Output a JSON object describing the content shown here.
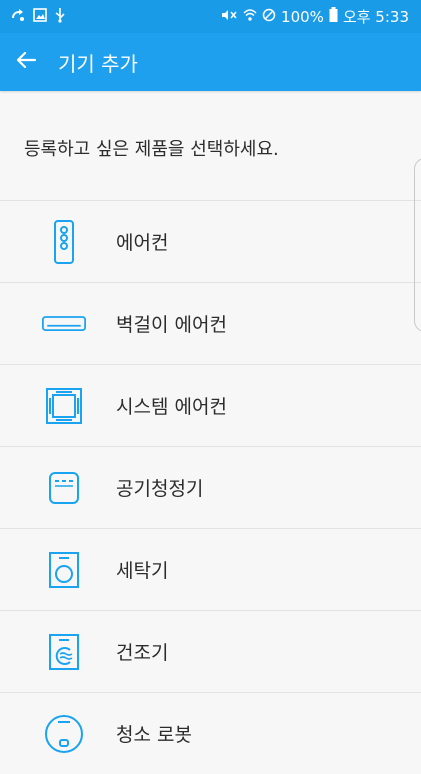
{
  "status_bar": {
    "battery_text": "100%",
    "time_text": "오후 5:33",
    "left_icons": [
      "sync-icon",
      "gallery-icon",
      "usb-icon"
    ],
    "right_icons": [
      "mute-icon",
      "wifi-icon",
      "no-disturb-icon",
      "battery-icon"
    ]
  },
  "app_bar": {
    "title": "기기 추가",
    "back_icon": "arrow-left-icon"
  },
  "prompt": "등록하고 싶은 제품을 선택하세요.",
  "devices": [
    {
      "label": "에어컨",
      "icon": "remote-icon"
    },
    {
      "label": "벽걸이 에어컨",
      "icon": "wall-ac-icon"
    },
    {
      "label": "시스템 에어컨",
      "icon": "system-ac-icon"
    },
    {
      "label": "공기청정기",
      "icon": "air-purifier-icon"
    },
    {
      "label": "세탁기",
      "icon": "washer-icon"
    },
    {
      "label": "건조기",
      "icon": "dryer-icon"
    },
    {
      "label": "청소 로봇",
      "icon": "robot-cleaner-icon"
    }
  ],
  "colors": {
    "status_bar": "#1a9be8",
    "app_bar": "#1ea0ef",
    "icon_accent": "#1aa3f0",
    "background": "#f7f7f7"
  }
}
